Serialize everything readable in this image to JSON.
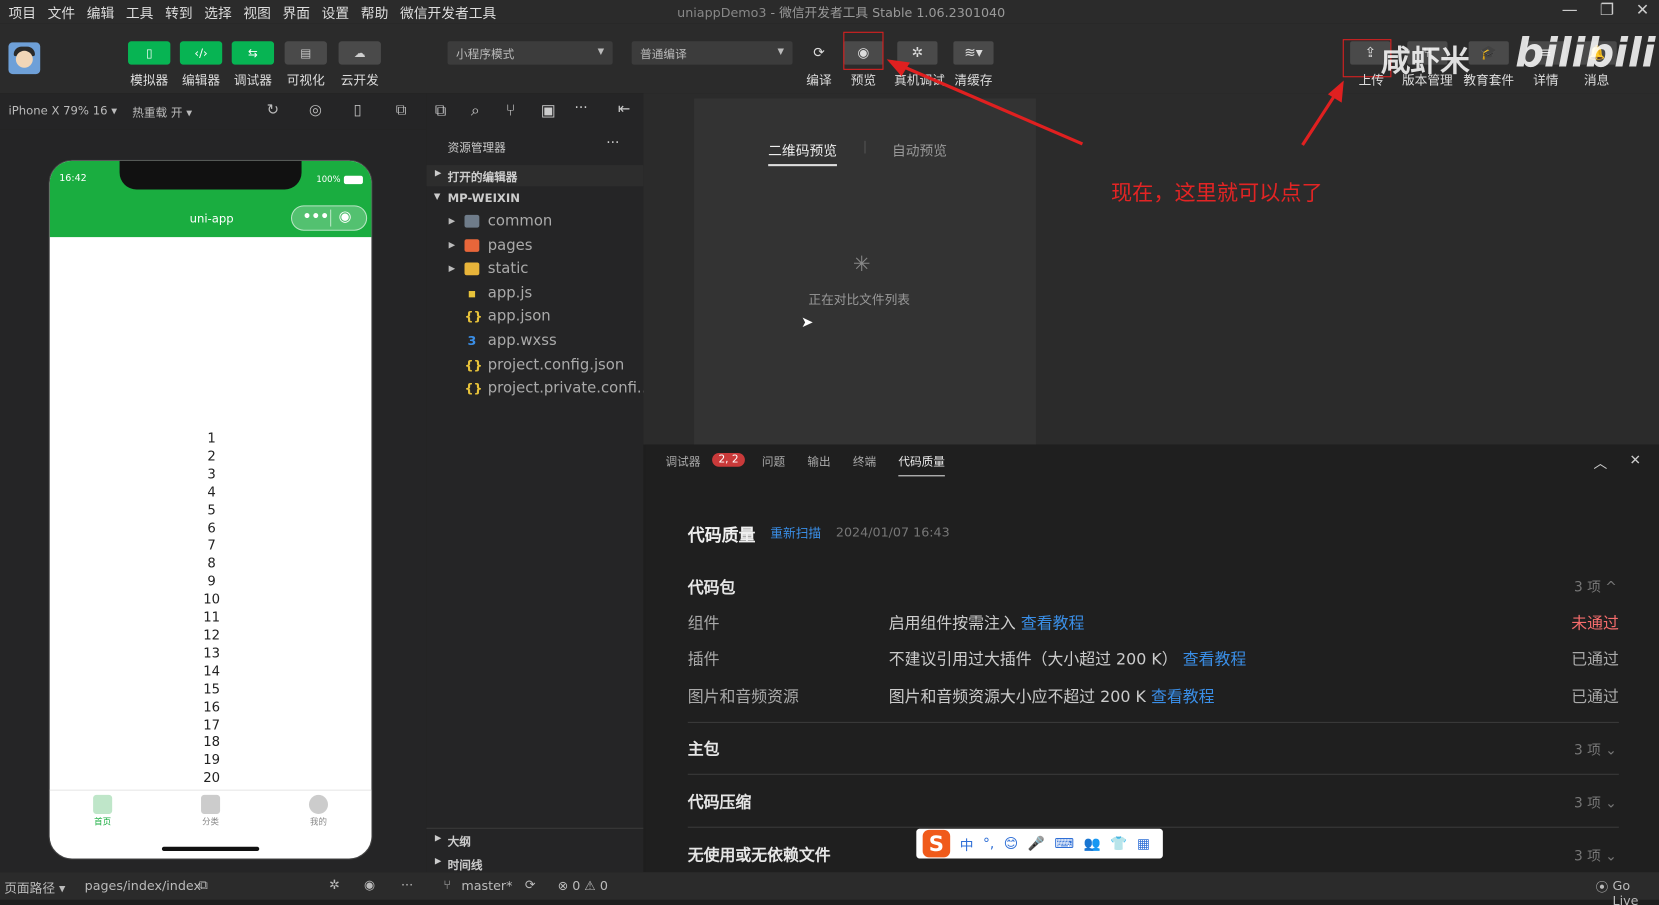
{
  "menu": {
    "items": [
      "项目",
      "文件",
      "编辑",
      "工具",
      "转到",
      "选择",
      "视图",
      "界面",
      "设置",
      "帮助",
      "微信开发者工具"
    ]
  },
  "window": {
    "title": "uniappDemo3",
    "title_suffix": " - 微信开发者工具 Stable 1.06.2301040"
  },
  "toolbar": {
    "buttons": [
      {
        "label": "模拟器"
      },
      {
        "label": "编辑器"
      },
      {
        "label": "调试器"
      },
      {
        "label": "可视化"
      },
      {
        "label": "云开发"
      }
    ],
    "mode_select": "小程序模式",
    "compile_select": "普通编译",
    "actions": [
      {
        "label": "编译"
      },
      {
        "label": "预览"
      },
      {
        "label": "真机调试"
      },
      {
        "label": "清缓存"
      }
    ],
    "right": [
      {
        "label": "上传"
      },
      {
        "label": "版本管理"
      },
      {
        "label": "教育套件"
      },
      {
        "label": "详情"
      },
      {
        "label": "消息"
      }
    ]
  },
  "watermark": {
    "text1": "咸虾米",
    "text2": "bilibili"
  },
  "simulator": {
    "device": "iPhone X 79% 16 ▾",
    "hot_reload": "热重载 开 ▾",
    "time": "16:42",
    "battery": "100%",
    "nav_title": "uni-app",
    "numbers": [
      "1",
      "2",
      "3",
      "4",
      "5",
      "6",
      "7",
      "8",
      "9",
      "10",
      "11",
      "12",
      "13",
      "14",
      "15",
      "16",
      "17",
      "18",
      "19",
      "20"
    ],
    "tabs": [
      {
        "label": "首页"
      },
      {
        "label": "分类"
      },
      {
        "label": "我的"
      }
    ]
  },
  "explorer": {
    "title": "资源管理器",
    "more": "···",
    "open_editors": "打开的编辑器",
    "root": "MP-WEIXIN",
    "files": [
      {
        "name": "common",
        "icon": "folder-icon",
        "color": "#6f7c8a"
      },
      {
        "name": "pages",
        "icon": "folder-icon",
        "color": "#e8663a"
      },
      {
        "name": "static",
        "icon": "folder-icon",
        "color": "#e8b43a"
      },
      {
        "name": "app.js",
        "icon": "js-file-icon",
        "color": "#e8c33a"
      },
      {
        "name": "app.json",
        "icon": "json-file-icon",
        "color": "#e8c33a"
      },
      {
        "name": "app.wxss",
        "icon": "wxss-file-icon",
        "color": "#3a8ee6"
      },
      {
        "name": "project.config.json",
        "icon": "json-file-icon",
        "color": "#e8c33a"
      },
      {
        "name": "project.private.confi...",
        "icon": "json-file-icon",
        "color": "#e8c33a"
      }
    ],
    "outline": "大纲",
    "timeline": "时间线"
  },
  "preview": {
    "tab_qr": "二维码预览",
    "tab_auto": "自动预览",
    "loading": "正在对比文件列表"
  },
  "annotation": "现在，这里就可以点了",
  "bottom_tabs": {
    "debugger": "调试器",
    "badge": "2, 2",
    "problems": "问题",
    "output": "输出",
    "terminal": "终端",
    "quality": "代码质量"
  },
  "code_quality": {
    "title": "代码质量",
    "rescan": "重新扫描",
    "time": "2024/01/07 16:43",
    "package": {
      "title": "代码包",
      "count": "3 项 ^",
      "rows": [
        {
          "name": "组件",
          "desc": "启用组件按需注入",
          "link": "查看教程",
          "status": "未通过",
          "status_color": "#f56c6c"
        },
        {
          "name": "插件",
          "desc": "不建议引用过大插件（大小超过 200 K）",
          "link": "查看教程",
          "status": "已通过",
          "status_color": "#aaaaaa"
        },
        {
          "name": "图片和音频资源",
          "desc": "图片和音频资源大小应不超过 200 K",
          "link": "查看教程",
          "status": "已通过",
          "status_color": "#aaaaaa"
        }
      ]
    },
    "main": {
      "title": "主包",
      "count": "3 项 ⌄"
    },
    "compress": {
      "title": "代码压缩",
      "count": "3 项 ⌄"
    },
    "unused": {
      "title": "无使用或无依赖文件",
      "count": "3 项 ⌄"
    }
  },
  "ime": {
    "logo": "S",
    "lang": "中",
    "punct": "°,",
    "icons": [
      "😊",
      "🎤",
      "⌨",
      "👥",
      "👕",
      "▦"
    ]
  },
  "statusbar": {
    "path_label": "页面路径 ▾",
    "path": "pages/index/index",
    "branch": "master*",
    "errors": "⊗ 0 ⚠ 0",
    "golive": "Go Live"
  }
}
